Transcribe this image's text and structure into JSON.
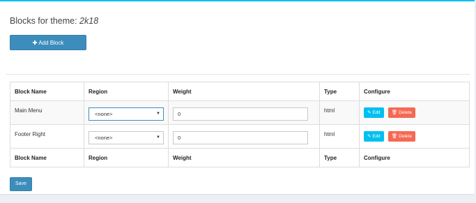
{
  "page": {
    "title_prefix": "Blocks for theme: ",
    "theme_name": "2k18",
    "add_block_label": "Add Block",
    "save_label": "Save"
  },
  "table": {
    "headers": [
      "Block Name",
      "Region",
      "Weight",
      "Type",
      "Configure"
    ],
    "footers": [
      "Block Name",
      "Region",
      "Weight",
      "Type",
      "Configure"
    ],
    "rows": [
      {
        "name": "Main Menu",
        "region": "<none>",
        "weight": "0",
        "type": "html",
        "edit": "Edit",
        "delete": "Delete"
      },
      {
        "name": "Footer Right",
        "region": "<none>",
        "weight": "0",
        "type": "html",
        "edit": "Edit",
        "delete": "Delete"
      }
    ]
  },
  "icons": {
    "add": "plus-icon",
    "edit": "edit-icon",
    "delete": "trash-icon",
    "select_caret": "caret-down-icon"
  },
  "colors": {
    "primary": "#3c8dbc",
    "info": "#00c0ef",
    "danger": "#f56954",
    "box_top_border": "#00c0ef"
  }
}
